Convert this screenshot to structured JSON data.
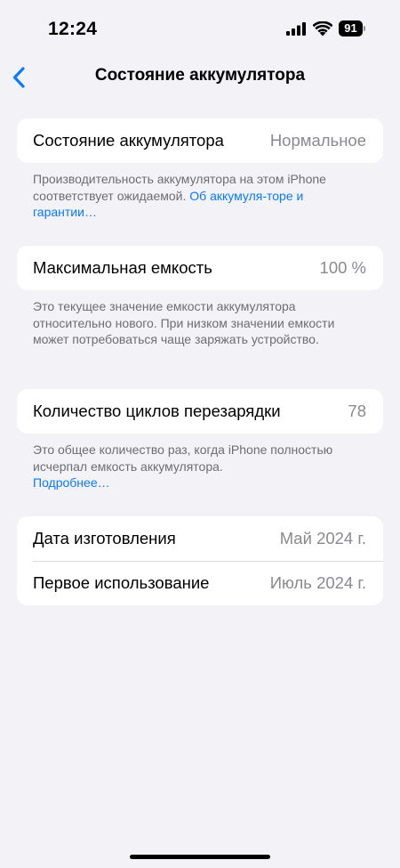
{
  "status_bar": {
    "time": "12:24",
    "battery_level": "91"
  },
  "nav": {
    "title": "Состояние аккумулятора"
  },
  "battery_health": {
    "label": "Состояние аккумулятора",
    "value": "Нормальное",
    "footnote_text": "Производительность аккумулятора на этом iPhone соответствует ожидаемой. ",
    "footnote_link": "Об аккумуля-торе и гарантии…"
  },
  "max_capacity": {
    "label": "Максимальная емкость",
    "value": "100 %",
    "footnote_text": "Это текущее значение емкости аккумулятора относительно нового. При низком значении емкости может потребоваться чаще заряжать устройство."
  },
  "cycle_count": {
    "label": "Количество циклов перезарядки",
    "value": "78",
    "footnote_text": "Это общее количество раз, когда iPhone полностью исчерпал емкость аккумулятора.",
    "footnote_link": "Подробнее…"
  },
  "dates": {
    "manufacture_label": "Дата изготовления",
    "manufacture_value": "Май 2024 г.",
    "first_use_label": "Первое использование",
    "first_use_value": "Июль 2024 г."
  },
  "colors": {
    "accent": "#0a7aff",
    "background": "#f2f2f7",
    "card": "#ffffff",
    "secondary_text": "#8a8a8e"
  }
}
